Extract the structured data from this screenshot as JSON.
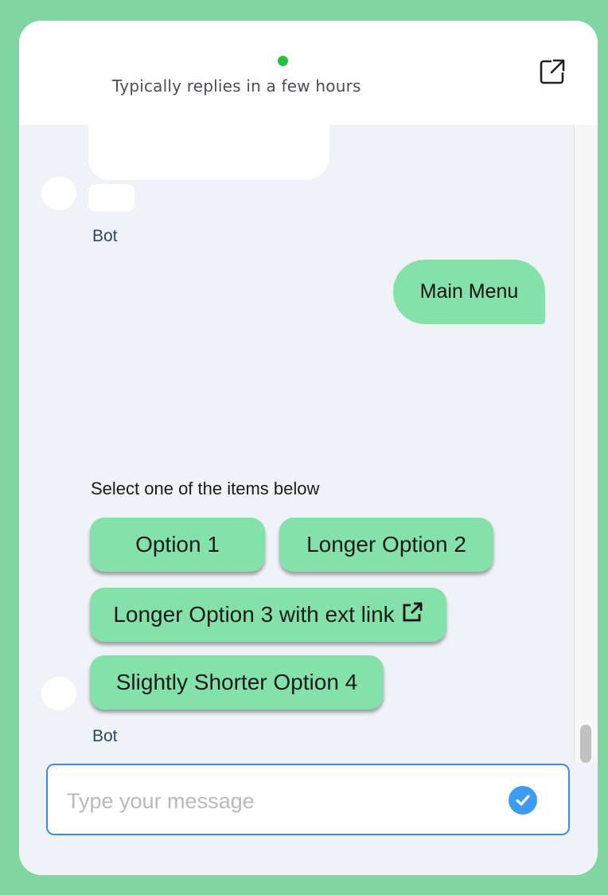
{
  "header": {
    "subtitle": "Typically replies in a few hours",
    "status_color": "#1ec43c",
    "popout_icon": "external-window-icon"
  },
  "messages": {
    "bot_label_1": "Bot",
    "user_message": "Main Menu",
    "prompt": "Select one of the items below",
    "bot_label_2": "Bot"
  },
  "options": [
    {
      "label": "Option 1"
    },
    {
      "label": "Longer Option 2"
    },
    {
      "label": "Longer Option 3 with ext link",
      "icon": "external-link-icon"
    },
    {
      "label": "Slightly Shorter Option 4"
    }
  ],
  "composer": {
    "placeholder": "Type your message",
    "send_icon": "checkmark-icon"
  },
  "colors": {
    "accent_green": "#83e1a9",
    "background": "#7fd6a0",
    "input_border": "#3d8de8",
    "send_button": "#3d9bf0"
  }
}
